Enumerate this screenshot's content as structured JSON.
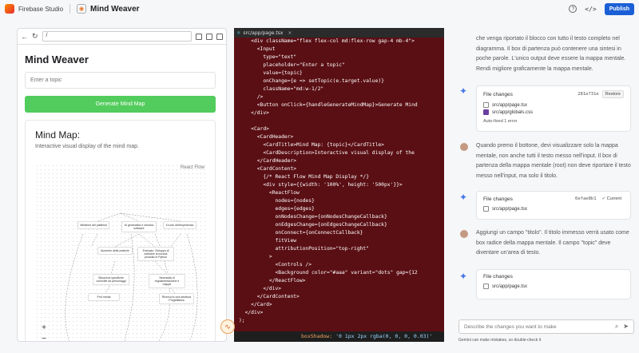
{
  "app": {
    "brand": "Firebase Studio",
    "project": "Mind Weaver",
    "publish_label": "Publish"
  },
  "preview": {
    "url": "/",
    "title": "Mind Weaver",
    "input_placeholder": "Enter a topic",
    "generate_label": "Generate Mind Map",
    "card_title": "Mind Map:",
    "card_desc": "Interactive visual display of the mind map.",
    "attribution": "React Flow",
    "nodes": [
      "Metafore del pattinisti",
      "AI generativa e robotics software",
      "Il ruolo dell'esperienza",
      "Aumento delle pratiche",
      "Esempio: Sviluppo di software di musica prodotto in Python",
      "Situazioni specifiche coinvolte da personaggi",
      "Necessità di regolamentazione e mappe",
      "Prof media",
      "Ricerca in una struttura Progettistica"
    ]
  },
  "editor": {
    "tab": "src/app/page.tsx",
    "lines": [
      "    <div className=\"flex flex-col md:flex-row gap-4 mb-4\">",
      "      <Input",
      "        type=\"text\"",
      "        placeholder=\"Enter a topic\"",
      "        value={topic}",
      "        onChange={e => setTopic(e.target.value)}",
      "        className=\"md:w-1/2\"",
      "      />",
      "      <Button onClick={handleGenerateMindMap}>Generate Mind",
      "    </div>",
      "",
      "    <Card>",
      "      <CardHeader>",
      "        <CardTitle>Mind Map: {topic}</CardTitle>",
      "        <CardDescription>Interactive visual display of the",
      "      </CardHeader>",
      "      <CardContent>",
      "        {/* React Flow Mind Map Display */}",
      "        <div style={{width: '100%', height: '500px'}}>",
      "          <ReactFlow",
      "            nodes={nodes}",
      "            edges={edges}",
      "            onNodesChange={onNodesChangeCallback}",
      "            onEdgesChange={onEdgesChangeCallback}",
      "            onConnect={onConnectCallback}",
      "            fitView",
      "            attributionPosition=\"top-right\"",
      "          >",
      "            <Controls />",
      "            <Background color=\"#aaa\" variant=\"dots\" gap={12",
      "          </ReactFlow>",
      "        </div>",
      "      </CardContent>",
      "    </Card>",
      "  </div>",
      ");"
    ],
    "status_key": "boxShadow:",
    "status_val": "'0 1px 2px rgba(0, 0, 0, 0.03)'"
  },
  "chat": {
    "msg1": "che venga riportato il blocco con tutto il testo completo nel diagramma. Il box di partenza può contenere una sintesi in poche parole. L'unico output deve essere la mappa mentale. Rendi migliore graficamente la mappa mentale.",
    "fc1": {
      "title": "File changes",
      "hash": "281e731e",
      "action": "Restore",
      "files": [
        "src/app/page.tsx",
        "src/app/globals.css"
      ],
      "note": "Auto-fixed 1 error"
    },
    "msg2": "Quando premo il bottone, devi visualizzare solo la mappa mentale, non anche tutti il testo messo nell'input. Il box di partenza della mappa mentale (root) non deve riportare il testo messo nell'input, ma solo il titolo.",
    "fc2": {
      "title": "File changes",
      "hash": "6efae8b1",
      "action": "Current",
      "files": [
        "src/app/page.tsx"
      ]
    },
    "msg3": "Aggiungi un campo \"titolo\". Il titolo immesso verrà usato come box radice della mappa mentale. Il campo \"topic\" deve diventare un'area di testo.",
    "fc3": {
      "title": "File changes",
      "files": [
        "src/app/page.tsx"
      ]
    },
    "prompt_placeholder": "Describe the changes you want to make",
    "disclaimer": "Gemini can make mistakes, so double-check it"
  }
}
